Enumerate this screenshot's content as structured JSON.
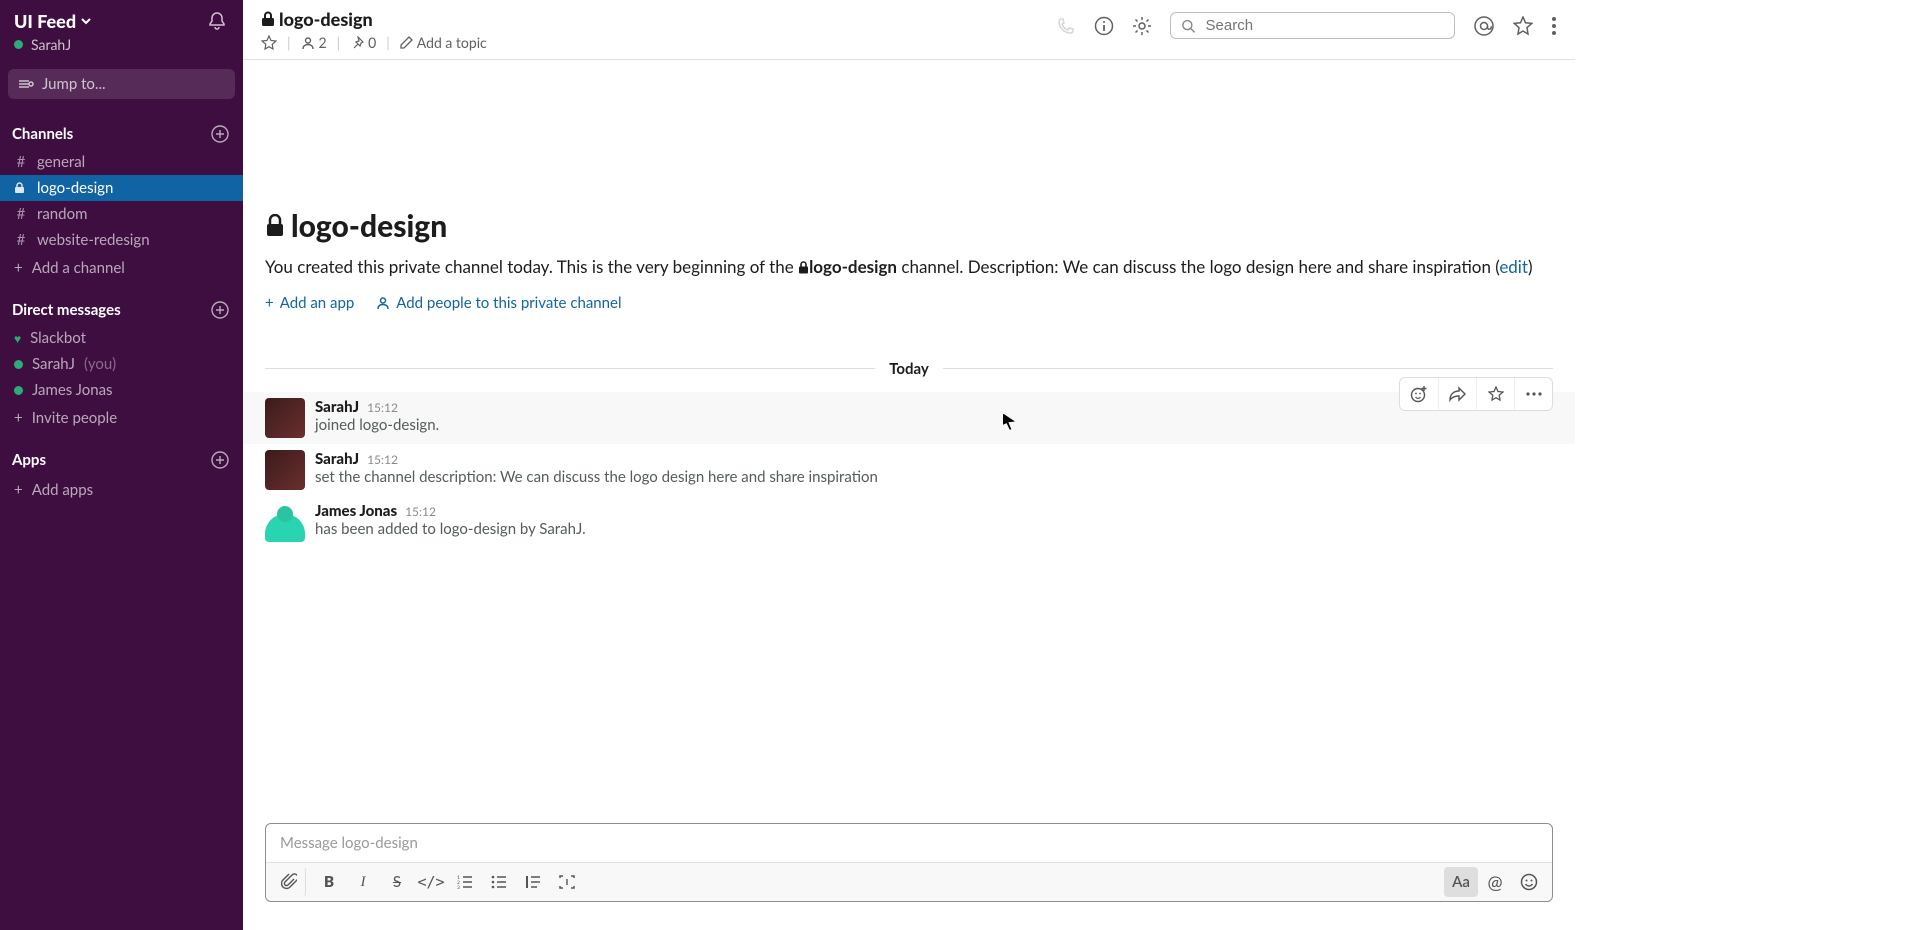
{
  "workspace": {
    "name": "UI Feed",
    "user_display": "SarahJ"
  },
  "jump_to": {
    "placeholder": "Jump to..."
  },
  "sections": {
    "channels": {
      "label": "Channels",
      "items": [
        {
          "type": "hash",
          "label": "general",
          "active": false
        },
        {
          "type": "lock",
          "label": "logo-design",
          "active": true
        },
        {
          "type": "hash",
          "label": "random",
          "active": false
        },
        {
          "type": "hash",
          "label": "website-redesign",
          "active": false
        }
      ],
      "add_label": "Add a channel"
    },
    "dms": {
      "label": "Direct messages",
      "items": [
        {
          "presence": "heart",
          "label": "Slackbot",
          "suffix": ""
        },
        {
          "presence": "dot",
          "label": "SarahJ",
          "suffix": "(you)"
        },
        {
          "presence": "dot",
          "label": "James Jonas",
          "suffix": ""
        }
      ],
      "invite_label": "Invite people"
    },
    "apps": {
      "label": "Apps",
      "add_label": "Add apps"
    }
  },
  "header": {
    "channel_name": "logo-design",
    "member_count": "2",
    "pin_count": "0",
    "add_topic_label": "Add a topic",
    "search_placeholder": "Search"
  },
  "intro": {
    "title": "logo-design",
    "text_1": "You created this private channel today. This is the very beginning of the ",
    "channel_bold": "logo-design",
    "text_2": " channel. Description: We can discuss the logo design here and share inspiration (",
    "edit_label": "edit",
    "text_3": ")",
    "add_app_label": "Add an app",
    "add_people_label": "Add people to this private channel"
  },
  "divider": {
    "label": "Today"
  },
  "messages": [
    {
      "avatar": "sarah",
      "name": "SarahJ",
      "time": "15:12",
      "text": "joined logo-design.",
      "hovered": true
    },
    {
      "avatar": "sarah",
      "name": "SarahJ",
      "time": "15:12",
      "text": "set the channel description: We can discuss the logo design here and share inspiration",
      "hovered": false
    },
    {
      "avatar": "james",
      "name": "James Jonas",
      "time": "15:12",
      "text": "has been added to logo-design by SarahJ.",
      "hovered": false
    }
  ],
  "composer": {
    "placeholder": "Message logo-design"
  }
}
